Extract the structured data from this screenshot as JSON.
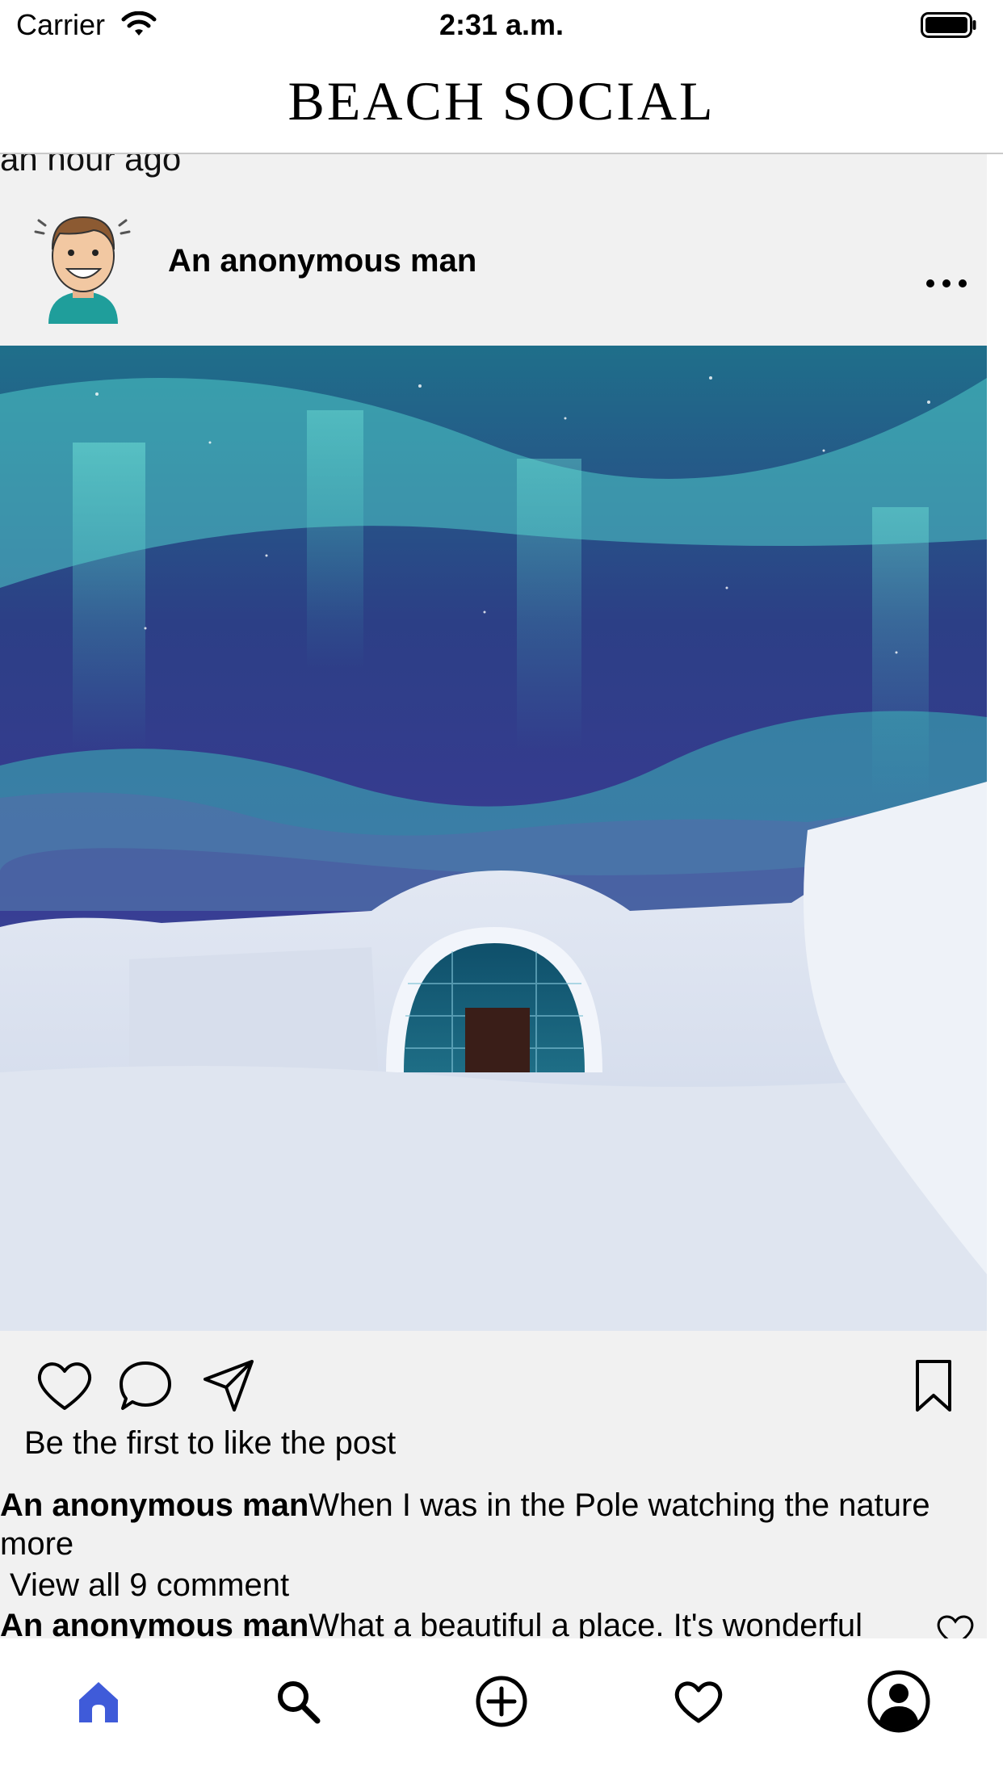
{
  "status_bar": {
    "carrier": "Carrier",
    "time": "2:31 a.m."
  },
  "header": {
    "title": "BEACH SOCIAL"
  },
  "post": {
    "timestamp": "an hour ago",
    "author": "An anonymous man",
    "likes_text": "Be the first to like the post",
    "caption_author": "An anonymous man",
    "caption_text": "When I was in the Pole watching the nature",
    "more_label": "more",
    "view_all": " View all 9 comment",
    "comment_author": "An anonymous man",
    "comment_text": "What a beautiful a place. It's wonderful"
  },
  "tab_bar": {
    "items": [
      {
        "icon": "home-icon",
        "active": true
      },
      {
        "icon": "search-icon",
        "active": false
      },
      {
        "icon": "add-post-icon",
        "active": false
      },
      {
        "icon": "heart-icon",
        "active": false
      },
      {
        "icon": "profile-icon",
        "active": false
      }
    ],
    "active_color": "#3f5bd9"
  }
}
